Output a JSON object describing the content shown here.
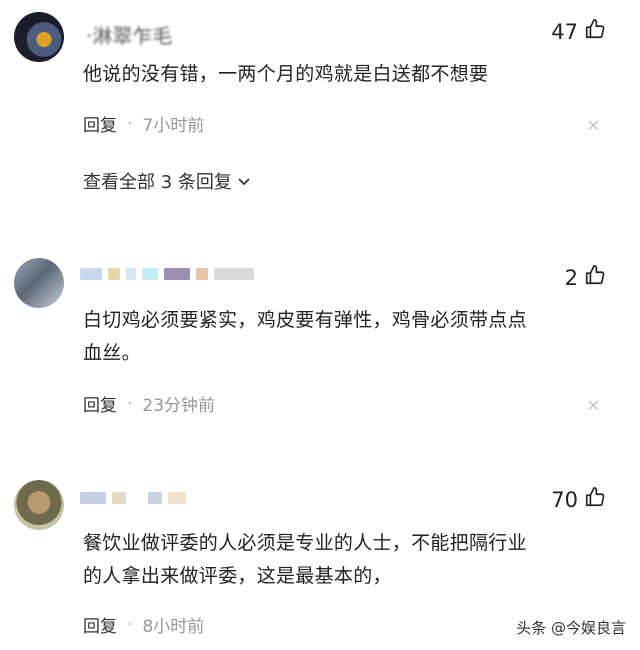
{
  "comments": [
    {
      "username": "·淋翠乍毛",
      "likes": "47",
      "text": "他说的没有错，一两个月的鸡就是白送都不想要",
      "reply_label": "回复",
      "time": "7小时前",
      "view_all": "查看全部 3 条回复"
    },
    {
      "likes": "2",
      "text_line1": "白切鸡必须要紧实，鸡皮要有弹性，鸡骨必须带点点",
      "text_line2": "血丝。",
      "reply_label": "回复",
      "time": "23分钟前"
    },
    {
      "likes": "70",
      "text_line1": "餐饮业做评委的人必须是专业的人士，不能把隔行业",
      "text_line2": "的人拿出来做评委，这是最基本的，",
      "reply_label": "回复",
      "time": "8小时前"
    }
  ],
  "icons": {
    "like": "thumbs-up-icon",
    "close": "close-icon",
    "expand": "chevron-down-icon"
  },
  "watermark": "头条 @今娱良言"
}
